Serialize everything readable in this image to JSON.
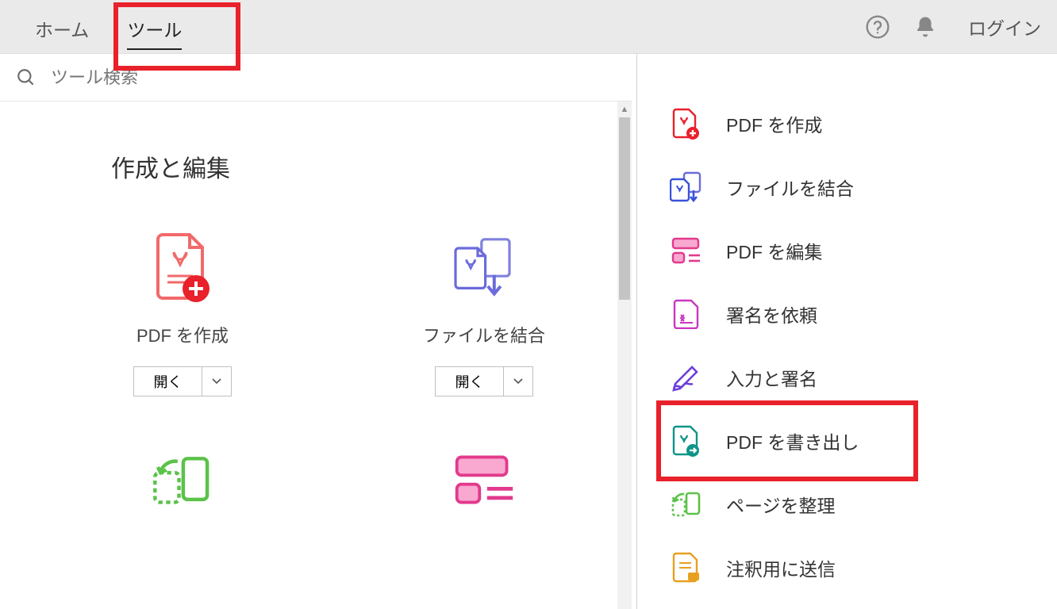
{
  "tabs": {
    "home": "ホーム",
    "tools": "ツール"
  },
  "login": "ログイン",
  "search": {
    "placeholder": "ツール検索"
  },
  "section": {
    "title": "作成と編集"
  },
  "tools": {
    "create": {
      "label": "PDF を作成",
      "open": "開く"
    },
    "combine": {
      "label": "ファイルを結合",
      "open": "開く"
    }
  },
  "sidebar": {
    "items": [
      {
        "label": "PDF を作成"
      },
      {
        "label": "ファイルを結合"
      },
      {
        "label": "PDF を編集"
      },
      {
        "label": "署名を依頼"
      },
      {
        "label": "入力と署名"
      },
      {
        "label": "PDF を書き出し"
      },
      {
        "label": "ページを整理"
      },
      {
        "label": "注釈用に送信"
      }
    ]
  }
}
